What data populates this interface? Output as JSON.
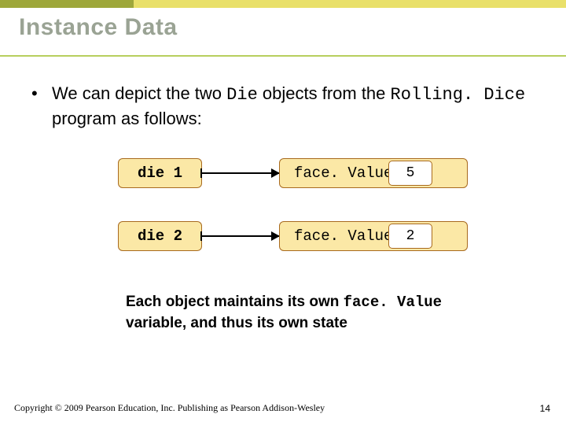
{
  "title": "Instance Data",
  "bullet": {
    "pre": "We can depict the two ",
    "code1": "Die",
    "mid": " objects from the ",
    "code2": "Rolling. Dice",
    "post": " program as follows:"
  },
  "diagram": {
    "rows": [
      {
        "var": "die 1",
        "field": "face. Value",
        "value": "5"
      },
      {
        "var": "die 2",
        "field": "face. Value",
        "value": "2"
      }
    ]
  },
  "caption": {
    "pre": "Each object maintains its own ",
    "code": "face. Value",
    "post": " variable, and thus its own state"
  },
  "footer": "Copyright © 2009 Pearson Education, Inc. Publishing as Pearson Addison-Wesley",
  "page": "14"
}
